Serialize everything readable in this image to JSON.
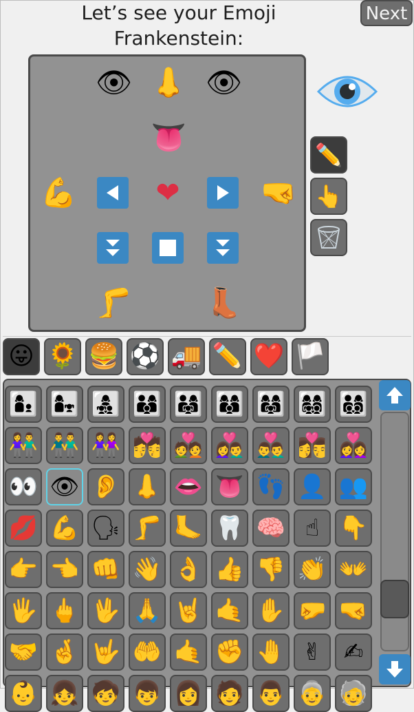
{
  "header": {
    "title_line1": "Let’s see your Emoji",
    "title_line2": "Frankenstein:",
    "next_label": "Next"
  },
  "canvas": {
    "left_eye": "👁",
    "nose": "👃",
    "right_eye": "👁",
    "tongue": "👅",
    "left_arm": "💪",
    "heart": "❤",
    "right_fist": "🤜",
    "leg": "🦵",
    "boot": "👢"
  },
  "preview": {
    "emoji_name": "eye"
  },
  "tools": [
    "✏️",
    "👆",
    "🗑"
  ],
  "categories": [
    "😛",
    "🌻",
    "🍔",
    "⚽",
    "🚚",
    "✏️",
    "❤️",
    "🏳️"
  ],
  "palette": {
    "rows": [
      [
        "👩‍👦",
        "👩‍👧",
        "👩‍👧‍👦",
        "👨‍👩‍👦",
        "👨‍👩‍👧",
        "👩‍👩‍👦",
        "👩‍👩‍👧",
        "👩‍👩‍👧‍👦",
        "👨‍👩‍👦‍👦"
      ],
      [
        "👫",
        "👬",
        "👭",
        "💏",
        "💑",
        "👩‍❤️‍👨",
        "👨‍❤️‍👨",
        "👩‍❤️‍💋‍👨",
        "👩‍❤️‍👩"
      ],
      [
        "👀",
        "👁",
        "👂",
        "👃",
        "👄",
        "👅",
        "👣",
        "👤",
        "👥"
      ],
      [
        "💋",
        "💪",
        "🗣",
        "🦵",
        "🦶",
        "🦷",
        "🧠",
        "☝",
        "👇"
      ],
      [
        "👉",
        "👈",
        "👊",
        "👋",
        "👌",
        "👍",
        "👎",
        "👏",
        "👐"
      ],
      [
        "🖐",
        "🖕",
        "🖖",
        "🙏",
        "🤘",
        "🤙",
        "✋",
        "🤛",
        "🤜"
      ],
      [
        "🤝",
        "🤞",
        "🤟",
        "🤲",
        "🤙",
        "✊",
        "🤚",
        "✌",
        "✍"
      ],
      [
        "👶",
        "👧",
        "🧒",
        "👦",
        "👩",
        "🧑",
        "👨",
        "👵",
        "🧓"
      ]
    ],
    "selected": "eye"
  },
  "colors": {
    "accent_blue": "#3b88c3",
    "heart_red": "#dd2e44",
    "skin_yellow": "#ffcc4d"
  }
}
